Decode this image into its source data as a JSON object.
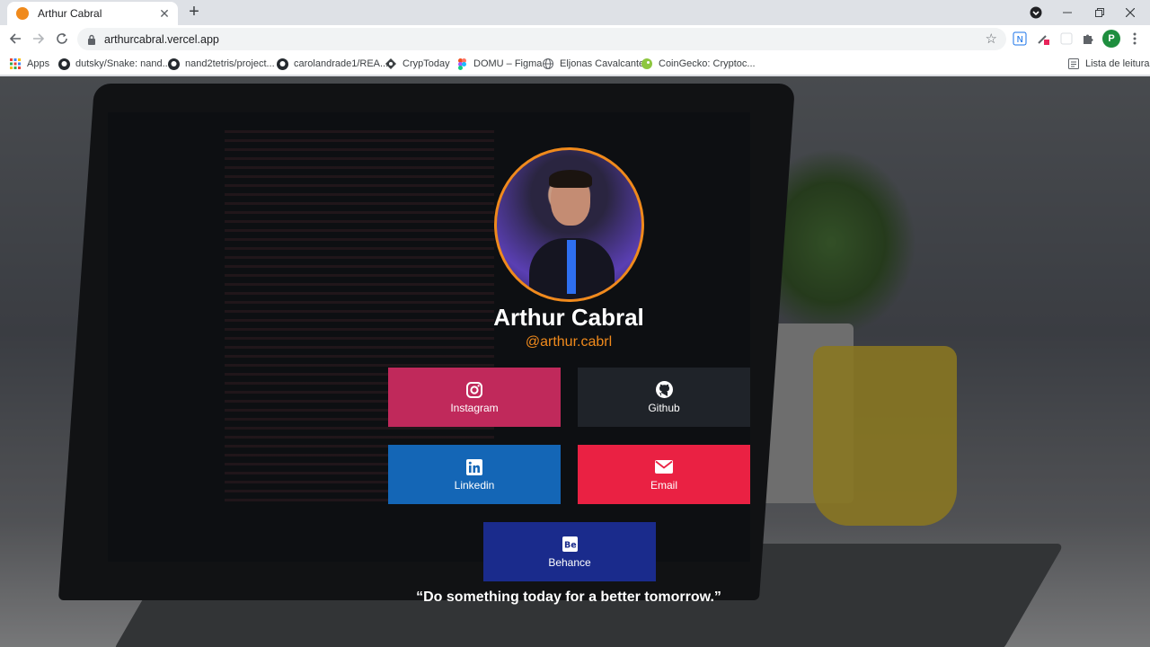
{
  "browser": {
    "tab": {
      "title": "Arthur Cabral",
      "close": "✕"
    },
    "newtab": "+",
    "url": "arthurcabral.vercel.app",
    "profile_initial": "P",
    "bookmarks": [
      {
        "label": "Apps",
        "icon": "apps-grid-icon"
      },
      {
        "label": "dutsky/Snake: nand...",
        "icon": "github-icon"
      },
      {
        "label": "nand2tetris/project...",
        "icon": "github-icon"
      },
      {
        "label": "carolandrade1/REA...",
        "icon": "github-icon"
      },
      {
        "label": "CrypToday",
        "icon": "crypto-icon"
      },
      {
        "label": "DOMU – Figma",
        "icon": "figma-icon"
      },
      {
        "label": "Eljonas Cavalcante",
        "icon": "globe-icon"
      },
      {
        "label": "CoinGecko: Cryptoc...",
        "icon": "coingecko-icon"
      }
    ],
    "reading_list": "Lista de leitura"
  },
  "profile": {
    "name": "Arthur Cabral",
    "handle": "@arthur.cabrl"
  },
  "links": [
    {
      "label": "Instagram",
      "color": "#c0295b",
      "icon": "instagram-icon"
    },
    {
      "label": "Github",
      "color": "#1f2329",
      "icon": "github-icon"
    },
    {
      "label": "Linkedin",
      "color": "#1466b6",
      "icon": "linkedin-icon"
    },
    {
      "label": "Email",
      "color": "#ea2143",
      "icon": "email-icon"
    },
    {
      "label": "Behance",
      "color": "#1a2b8c",
      "icon": "behance-icon"
    }
  ],
  "quote": "“Do something today for a better tomorrow.”",
  "colors": {
    "accent": "#f08a1c"
  }
}
